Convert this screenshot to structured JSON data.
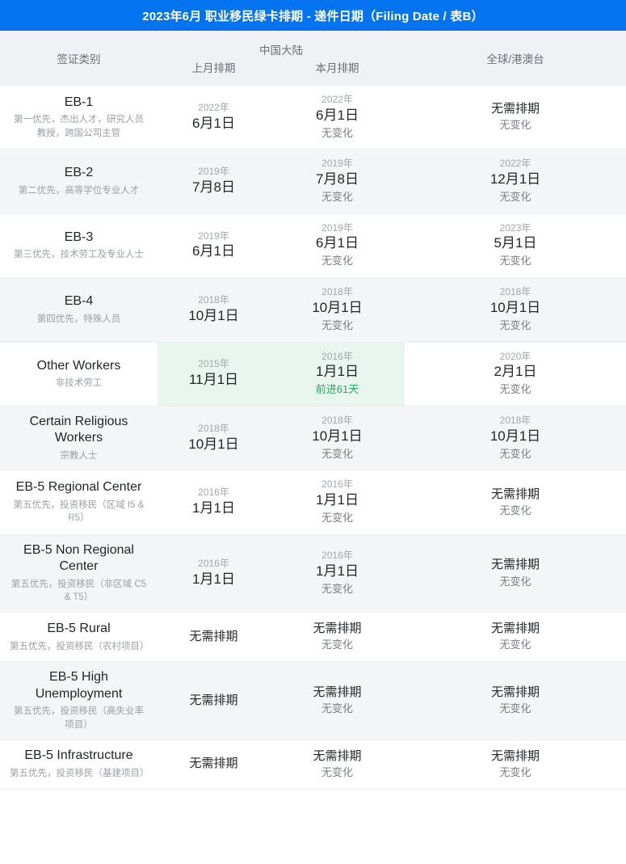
{
  "header": {
    "title": "2023年6月 职业移民绿卡排期 - 递件日期（Filing Date / 表B）",
    "accent_color": "#0473f0"
  },
  "colors": {
    "accent": "#0473f0",
    "highlight_bg": "#e9f6ef",
    "advance_text": "#2ba35f",
    "header_bg": "#f0f1f4",
    "row_even_bg": "#f4f5f6",
    "row_odd_bg": "#ffffff"
  },
  "columns": {
    "category": "签证类别",
    "china_group": "中国大陆",
    "china_prev": "上月排期",
    "china_curr": "本月排期",
    "global": "全球/港澳台"
  },
  "labels": {
    "no_wait": "无需排期",
    "no_change": "无变化"
  },
  "rows": [
    {
      "name": "EB-1",
      "desc": "第一优先，杰出人才，研究人员\n教授，跨国公司主管",
      "china_prev": {
        "year": "2022年",
        "date": "6月1日"
      },
      "china_curr": {
        "year": "2022年",
        "date": "6月1日",
        "note": "无变化",
        "advanced": false,
        "highlight": false
      },
      "global": {
        "year": "",
        "date": "无需排期",
        "note": "无变化",
        "no_wait": true
      }
    },
    {
      "name": "EB-2",
      "desc": "第二优先，高等学位专业人才",
      "china_prev": {
        "year": "2019年",
        "date": "7月8日"
      },
      "china_curr": {
        "year": "2019年",
        "date": "7月8日",
        "note": "无变化",
        "advanced": false,
        "highlight": false
      },
      "global": {
        "year": "2022年",
        "date": "12月1日",
        "note": "无变化",
        "no_wait": false
      }
    },
    {
      "name": "EB-3",
      "desc": "第三优先，技术劳工及专业人士",
      "china_prev": {
        "year": "2019年",
        "date": "6月1日"
      },
      "china_curr": {
        "year": "2019年",
        "date": "6月1日",
        "note": "无变化",
        "advanced": false,
        "highlight": false
      },
      "global": {
        "year": "2023年",
        "date": "5月1日",
        "note": "无变化",
        "no_wait": false
      }
    },
    {
      "name": "EB-4",
      "desc": "第四优先，特殊人员",
      "china_prev": {
        "year": "2018年",
        "date": "10月1日"
      },
      "china_curr": {
        "year": "2018年",
        "date": "10月1日",
        "note": "无变化",
        "advanced": false,
        "highlight": false
      },
      "global": {
        "year": "2018年",
        "date": "10月1日",
        "note": "无变化",
        "no_wait": false
      }
    },
    {
      "name": "Other Workers",
      "desc": "非技术劳工",
      "china_prev": {
        "year": "2015年",
        "date": "11月1日"
      },
      "china_curr": {
        "year": "2016年",
        "date": "1月1日",
        "note": "前进61天",
        "advanced": true,
        "highlight": true
      },
      "global": {
        "year": "2020年",
        "date": "2月1日",
        "note": "无变化",
        "no_wait": false
      }
    },
    {
      "name": "Certain Religious Workers",
      "desc": "宗教人士",
      "china_prev": {
        "year": "2018年",
        "date": "10月1日"
      },
      "china_curr": {
        "year": "2018年",
        "date": "10月1日",
        "note": "无变化",
        "advanced": false,
        "highlight": false
      },
      "global": {
        "year": "2018年",
        "date": "10月1日",
        "note": "无变化",
        "no_wait": false
      }
    },
    {
      "name": "EB-5 Regional Center",
      "desc": "第五优先，投资移民（区域 I5 & R5）",
      "china_prev": {
        "year": "2016年",
        "date": "1月1日"
      },
      "china_curr": {
        "year": "2016年",
        "date": "1月1日",
        "note": "无变化",
        "advanced": false,
        "highlight": false
      },
      "global": {
        "year": "",
        "date": "无需排期",
        "note": "无变化",
        "no_wait": true
      }
    },
    {
      "name": "EB-5 Non Regional Center",
      "desc": "第五优先，投资移民（非区域 C5 & T5）",
      "china_prev": {
        "year": "2016年",
        "date": "1月1日"
      },
      "china_curr": {
        "year": "2016年",
        "date": "1月1日",
        "note": "无变化",
        "advanced": false,
        "highlight": false
      },
      "global": {
        "year": "",
        "date": "无需排期",
        "note": "无变化",
        "no_wait": true
      }
    },
    {
      "name": "EB-5 Rural",
      "desc": "第五优先，投资移民（农村项目）",
      "china_prev": {
        "year": "",
        "date": "无需排期",
        "no_wait": true
      },
      "china_curr": {
        "year": "",
        "date": "无需排期",
        "note": "无变化",
        "advanced": false,
        "highlight": false,
        "no_wait": true
      },
      "global": {
        "year": "",
        "date": "无需排期",
        "note": "无变化",
        "no_wait": true
      }
    },
    {
      "name": "EB-5 High Unemployment",
      "desc": "第五优先，投资移民（高失业率项目）",
      "china_prev": {
        "year": "",
        "date": "无需排期",
        "no_wait": true
      },
      "china_curr": {
        "year": "",
        "date": "无需排期",
        "note": "无变化",
        "advanced": false,
        "highlight": false,
        "no_wait": true
      },
      "global": {
        "year": "",
        "date": "无需排期",
        "note": "无变化",
        "no_wait": true
      }
    },
    {
      "name": "EB-5 Infrastructure",
      "desc": "第五优先，投资移民（基建项目）",
      "china_prev": {
        "year": "",
        "date": "无需排期",
        "no_wait": true
      },
      "china_curr": {
        "year": "",
        "date": "无需排期",
        "note": "无变化",
        "advanced": false,
        "highlight": false,
        "no_wait": true
      },
      "global": {
        "year": "",
        "date": "无需排期",
        "note": "无变化",
        "no_wait": true
      }
    }
  ]
}
